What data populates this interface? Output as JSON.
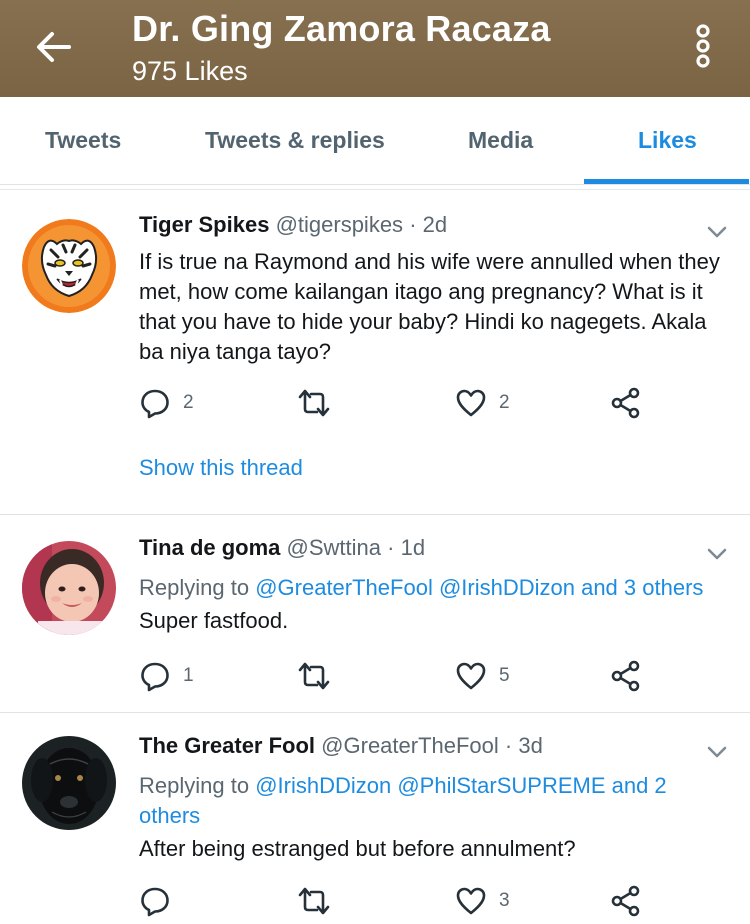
{
  "header": {
    "title": "Dr. Ging Zamora Racaza",
    "subtitle": "975 Likes",
    "back_icon": "arrow-left-icon",
    "more_icon": "more-vertical-icon",
    "background_color": "#7f6848"
  },
  "tabs": [
    {
      "label": "Tweets",
      "active": false
    },
    {
      "label": "Tweets & replies",
      "active": false
    },
    {
      "label": "Media",
      "active": false
    },
    {
      "label": "Likes",
      "active": true
    }
  ],
  "accent_color": "#1d8ce0",
  "tweets": [
    {
      "name": "Tiger Spikes",
      "handle": "@tigerspikes",
      "time": "· 2d",
      "text": "If is true na Raymond and his wife were annulled when they met, how come kailangan itago ang pregnancy? What is it that you have to hide your baby? Hindi ko nagegets. Akala ba niya tanga tayo?",
      "replies": "2",
      "retweets": "",
      "likes": "2",
      "show_thread": "Show this thread"
    },
    {
      "name": "Tina de goma",
      "handle": "@Swttina",
      "time": "· 1d",
      "replying_prefix": "Replying to",
      "replying_mentions": "@GreaterTheFool @IrishDDizon and 3 others",
      "text": "Super fastfood.",
      "replies": "1",
      "retweets": "",
      "likes": "5"
    },
    {
      "name": "The Greater Fool",
      "handle": "@GreaterTheFool",
      "time": "· 3d",
      "replying_prefix": "Replying to",
      "replying_mentions": "@IrishDDizon @PhilStarSUPREME and 2 others",
      "text": "After being estranged but before annulment?",
      "replies": "",
      "retweets": "",
      "likes": "3"
    }
  ]
}
